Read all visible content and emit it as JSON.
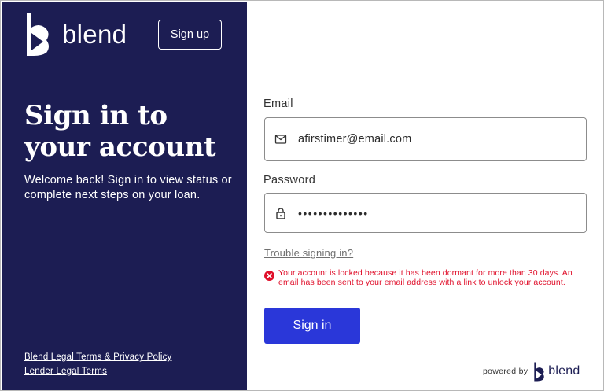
{
  "brand": {
    "name": "blend",
    "logo_icon": "blend-logo-icon"
  },
  "header": {
    "signup_label": "Sign up"
  },
  "hero": {
    "title": "Sign in to your account",
    "subtitle": "Welcome back! Sign in to view status or complete next steps on your loan."
  },
  "legal": {
    "links": [
      "Blend Legal Terms & Privacy Policy",
      "Lender Legal Terms"
    ]
  },
  "form": {
    "email": {
      "label": "Email",
      "value": "afirstimer@email.com",
      "icon": "mail-icon"
    },
    "password": {
      "label": "Password",
      "value": "••••••••••••••",
      "icon": "lock-icon"
    },
    "trouble_link": "Trouble signing in?",
    "error": {
      "icon": "error-circle-icon",
      "message": "Your account is locked because it has been dormant for more than 30 days. An email has been sent to your email address with a link to unlock your account."
    },
    "submit_label": "Sign in"
  },
  "footer": {
    "powered_by": "powered by",
    "brand_name": "blend"
  },
  "colors": {
    "panel_bg": "#1c1d53",
    "primary_button": "#2a37d9",
    "error": "#e0102b"
  }
}
